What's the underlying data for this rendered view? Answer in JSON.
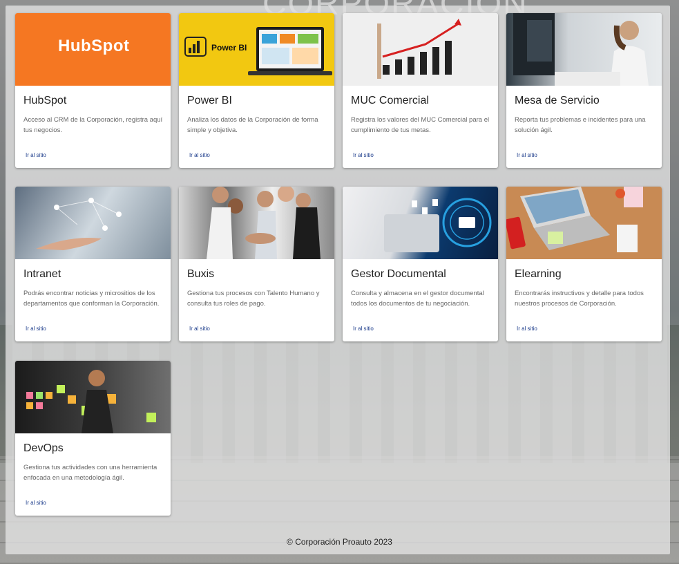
{
  "background": {
    "logo_text": "CORPORACION"
  },
  "cards": [
    {
      "title": "HubSpot",
      "description": "Acceso al CRM de la Corporación, registra aquí tus negocios.",
      "link": "Ir al sitio",
      "thumb_logo": "HubSpot"
    },
    {
      "title": "Power BI",
      "description": "Analiza los datos de la Corporación de forma simple y objetiva.",
      "link": "Ir al sitio",
      "thumb_logo": "Power BI"
    },
    {
      "title": "MUC Comercial",
      "description": "Registra los valores del MUC Comercial para el cumplimiento de tus metas.",
      "link": "Ir al sitio"
    },
    {
      "title": "Mesa de Servicio",
      "description": "Reporta tus problemas e incidentes para una solución ágil.",
      "link": "Ir al sitio"
    },
    {
      "title": "Intranet",
      "description": "Podrás encontrar noticias y micrositios de los departamentos que conforman la Corporación.",
      "link": "Ir al sitio"
    },
    {
      "title": "Buxis",
      "description": "Gestiona tus procesos con Talento Humano y consulta tus roles de pago.",
      "link": "Ir al sitio"
    },
    {
      "title": "Gestor Documental",
      "description": "Consulta y almacena en el gestor documental todos los documentos de tu negociación.",
      "link": "Ir al sitio"
    },
    {
      "title": "Elearning",
      "description": "Encontrarás instructivos y detalle para todos nuestros procesos de Corporación.",
      "link": "Ir al sitio"
    },
    {
      "title": "DevOps",
      "description": "Gestiona tus actividades con una herramienta enfocada en una metodología ágil.",
      "link": "Ir al sitio"
    }
  ],
  "footer": {
    "text": "© Corporación Proauto 2023"
  }
}
